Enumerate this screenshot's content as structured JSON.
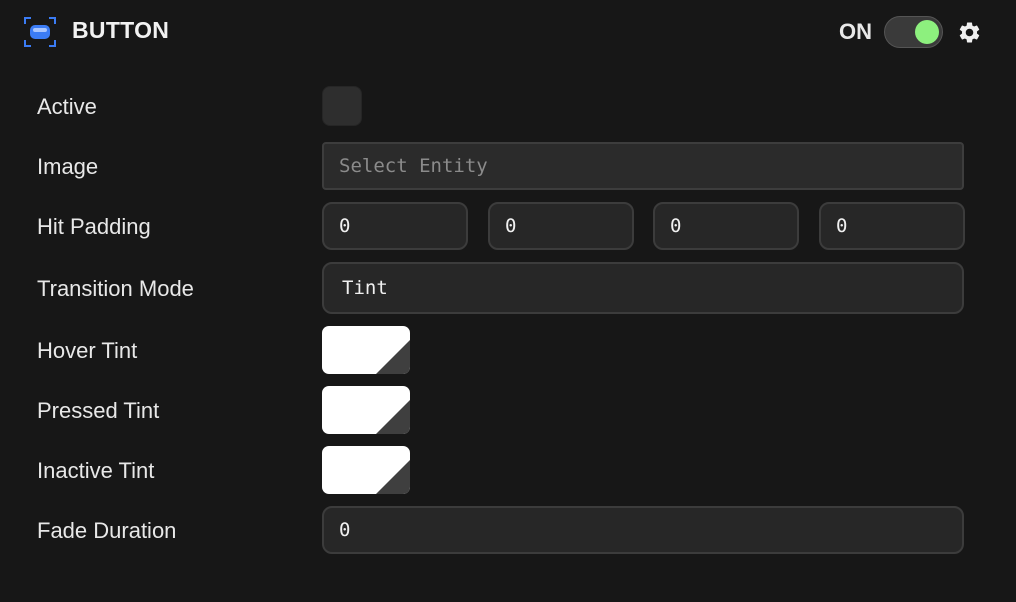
{
  "header": {
    "title": "BUTTON",
    "enabled_label": "ON",
    "enabled": true,
    "icons": {
      "component": "button-component-icon",
      "settings": "gear-icon"
    },
    "colors": {
      "accent": "#3b7cf5",
      "toggle_on": "#8df07e"
    }
  },
  "fields": {
    "active": {
      "label": "Active",
      "checked": false
    },
    "image": {
      "label": "Image",
      "placeholder": "Select Entity",
      "value": ""
    },
    "hit_padding": {
      "label": "Hit Padding",
      "values": [
        "0",
        "0",
        "0",
        "0"
      ]
    },
    "transition_mode": {
      "label": "Transition Mode",
      "value": "Tint"
    },
    "hover_tint": {
      "label": "Hover Tint",
      "color": "#ffffff"
    },
    "pressed_tint": {
      "label": "Pressed Tint",
      "color": "#ffffff"
    },
    "inactive_tint": {
      "label": "Inactive Tint",
      "color": "#ffffff"
    },
    "fade_duration": {
      "label": "Fade Duration",
      "value": "0"
    }
  }
}
